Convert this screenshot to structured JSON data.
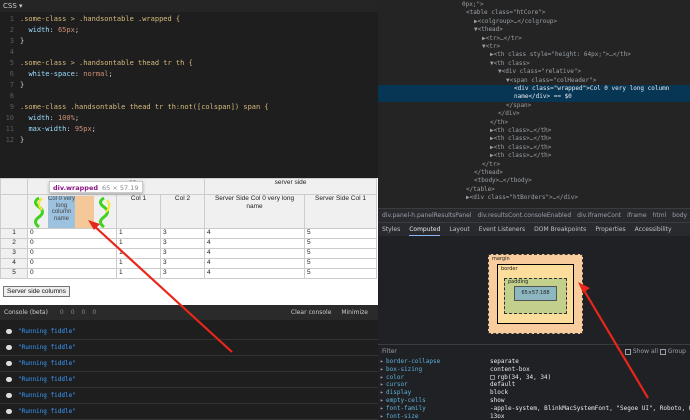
{
  "css_editor": {
    "header": "CSS ▾",
    "lines": [
      {
        "n": "1",
        "sel": ".some-class > .handsontable .wrapped {"
      },
      {
        "n": "2",
        "prop": "width",
        "val": "65px"
      },
      {
        "n": "3",
        "pun": "}"
      },
      {
        "n": "4"
      },
      {
        "n": "5",
        "sel": ".some-class > .handsontable thead tr th {"
      },
      {
        "n": "6",
        "prop": "white-space",
        "val": "normal"
      },
      {
        "n": "7",
        "pun": "}"
      },
      {
        "n": "8"
      },
      {
        "n": "9",
        "sel": ".some-class .handsontable thead tr th:not([colspan]) span {"
      },
      {
        "n": "10",
        "prop": "width",
        "val": "100%"
      },
      {
        "n": "11",
        "prop": "max-width",
        "val": "95px"
      },
      {
        "n": "12",
        "pun": "}"
      }
    ]
  },
  "elements": {
    "lines": [
      "0px;\">",
      "<table class=\"htCore\">",
      "▶<colgroup>…</colgroup>",
      "▼<thead>",
      "▶<tr>…</tr>",
      "▼<tr>",
      "▶<th class style=\"height: 64px;\">…</th>",
      "▼<th class>",
      "▼<div class=\"relative\">",
      "▼<span class=\"colHeader\">",
      "<div class=\"wrapped\">Col 0 very long column",
      "name</div> == $0",
      "</span>",
      "</div>",
      "</th>",
      "▶<th class>…</th>",
      "▶<th class>…</th>",
      "▶<th class>…</th>",
      "▶<th class>…</th>",
      "</tr>",
      "</thead>",
      "<tbody>…</tbody>",
      "</table>",
      "▶<div class=\"htBorders\">…</div>"
    ]
  },
  "breadcrumbs": [
    "div.panel-h.panelResultsPanel",
    "div.resultsCont.consoleEnabled",
    "div.iframeCont",
    "iframe",
    "html",
    "body",
    "‹"
  ],
  "tabs": [
    "Styles",
    "Computed",
    "Layout",
    "Event Listeners",
    "DOM Breakpoints",
    "Properties",
    "Accessibility"
  ],
  "active_tab": "Computed",
  "box_model": {
    "margin": "margin",
    "border": "border",
    "padding": "padding",
    "content": "65×57.188",
    "dash": "-"
  },
  "filter": {
    "placeholder": "Filter",
    "show_all": "Show all",
    "group": "Group"
  },
  "computed": [
    {
      "name": "border-collapse",
      "value": "separate"
    },
    {
      "name": "box-sizing",
      "value": "content-box"
    },
    {
      "name": "color",
      "value": "rgb(34, 34, 34)",
      "swatch": "#222222"
    },
    {
      "name": "cursor",
      "value": "default"
    },
    {
      "name": "display",
      "value": "block"
    },
    {
      "name": "empty-cells",
      "value": "show"
    },
    {
      "name": "font-family",
      "value": "-apple-system, BlinkMacSystemFont, \"Segoe UI\", Roboto, Oxyge"
    },
    {
      "name": "font-size",
      "value": "13px"
    }
  ],
  "result": {
    "header_top": [
      "",
      "an",
      "server side"
    ],
    "header_cols": [
      "",
      "Col 0 very long column name",
      "Col 1",
      "Col 2",
      "Server Side Col 0 very long name",
      "Server Side Col 1"
    ],
    "rows": [
      [
        "1",
        "0",
        "1",
        "3",
        "4",
        "5"
      ],
      [
        "2",
        "0",
        "1",
        "3",
        "4",
        "5"
      ],
      [
        "3",
        "0",
        "1",
        "3",
        "4",
        "5"
      ],
      [
        "4",
        "0",
        "1",
        "3",
        "4",
        "5"
      ],
      [
        "5",
        "0",
        "1",
        "3",
        "4",
        "5"
      ]
    ],
    "tooltip": {
      "name": "div.wrapped",
      "size": "65 × 57.19"
    },
    "button": "Server side columns"
  },
  "console": {
    "title": "Console (beta)",
    "counts": [
      "0",
      "0",
      "0",
      "0"
    ],
    "clear": "Clear console",
    "minimize": "Minimize",
    "messages": [
      "\"Running fiddle\"",
      "\"Running fiddle\"",
      "\"Running fiddle\"",
      "\"Running fiddle\"",
      "\"Running fiddle\"",
      "\"Running fiddle\""
    ]
  },
  "colors": {
    "arrow": "#e8261b",
    "highlight": "#073655",
    "wrapped_bg": "#f5c89a",
    "wrapped_fg": "#9dc2e0"
  }
}
